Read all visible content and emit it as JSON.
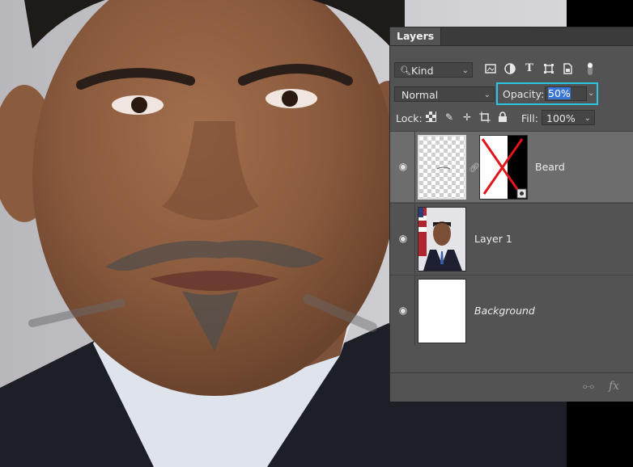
{
  "panel": {
    "tab_label": "Layers",
    "kind_filter": "Kind",
    "blend_mode": "Normal",
    "opacity_label": "Opacity:",
    "opacity_value": "50%",
    "lock_label": "Lock:",
    "fill_label": "Fill:",
    "fill_value": "100%"
  },
  "layers": [
    {
      "name": "Beard",
      "visible": true,
      "selected": true,
      "has_mask": true
    },
    {
      "name": "Layer 1",
      "visible": true,
      "selected": false,
      "has_mask": false
    },
    {
      "name": "Background",
      "visible": true,
      "selected": false,
      "italic": true
    }
  ],
  "filter_icons": [
    "pixel-filter-icon",
    "adjustment-filter-icon",
    "type-filter-icon",
    "shape-filter-icon",
    "smart-object-filter-icon",
    "filter-toggle-icon"
  ],
  "lock_icons": [
    "lock-transparent-icon",
    "lock-image-icon",
    "lock-position-icon",
    "lock-artboard-icon",
    "lock-all-icon"
  ],
  "footer_icons": [
    "link-layers-icon",
    "fx-icon"
  ],
  "colors": {
    "panel_bg": "#535353",
    "selected_row": "#6d6d6d",
    "highlight_border": "#2ec6e6",
    "selection": "#3a76d8"
  }
}
